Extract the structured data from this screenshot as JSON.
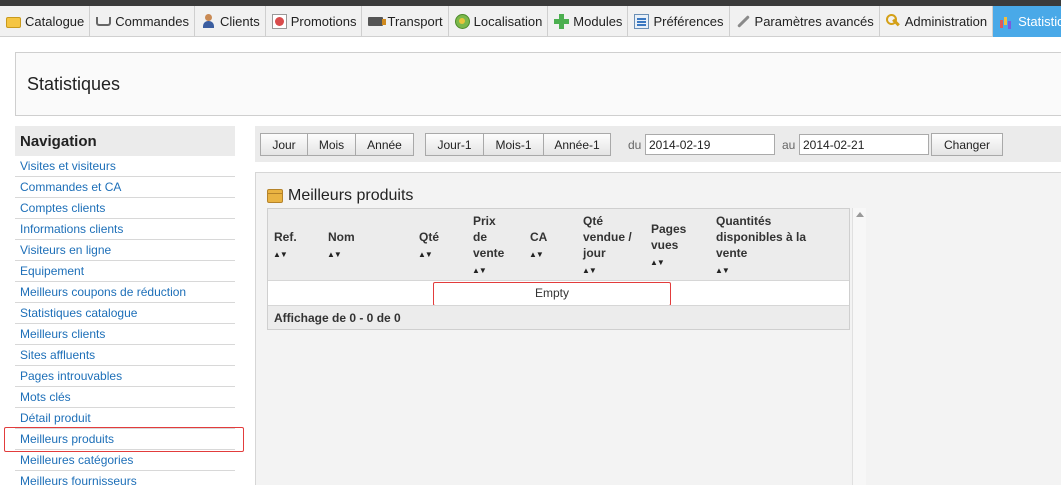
{
  "tabs": [
    {
      "label": "Catalogue",
      "icon": "folder-icon"
    },
    {
      "label": "Commandes",
      "icon": "cart-icon"
    },
    {
      "label": "Clients",
      "icon": "user-icon"
    },
    {
      "label": "Promotions",
      "icon": "promotion-icon"
    },
    {
      "label": "Transport",
      "icon": "truck-icon"
    },
    {
      "label": "Localisation",
      "icon": "globe-icon"
    },
    {
      "label": "Modules",
      "icon": "puzzle-icon"
    },
    {
      "label": "Préférences",
      "icon": "preferences-icon"
    },
    {
      "label": "Paramètres avancés",
      "icon": "wrench-icon"
    },
    {
      "label": "Administration",
      "icon": "key-icon"
    },
    {
      "label": "Statistiques",
      "icon": "stats-icon",
      "active": true
    }
  ],
  "page": {
    "title": "Statistiques"
  },
  "nav": {
    "title": "Navigation",
    "items": [
      "Visites et visiteurs",
      "Commandes et CA",
      "Comptes clients",
      "Informations clients",
      "Visiteurs en ligne",
      "Equipement",
      "Meilleurs coupons de réduction",
      "Statistiques catalogue",
      "Meilleurs clients",
      "Sites affluents",
      "Pages introuvables",
      "Mots clés",
      "Détail produit",
      "Meilleurs produits",
      "Meilleures catégories",
      "Meilleurs fournisseurs"
    ],
    "selected": "Meilleurs produits"
  },
  "toolbar": {
    "jour": "Jour",
    "mois": "Mois",
    "annee": "Année",
    "jour1": "Jour-1",
    "mois1": "Mois-1",
    "annee1": "Année-1",
    "du_label": "du",
    "du_value": "2014-02-19",
    "au_label": "au",
    "au_value": "2014-02-21",
    "changer": "Changer"
  },
  "section": {
    "title": "Meilleurs produits",
    "columns": {
      "ref": "Ref.",
      "nom": "Nom",
      "qte": "Qté",
      "prix1": "Prix",
      "prix2": "de",
      "prix3": "vente",
      "ca": "CA",
      "qv1": "Qté",
      "qv2": "vendue /",
      "qv3": "jour",
      "pv1": "Pages",
      "pv2": "vues",
      "qd1": "Quantités",
      "qd2": "disponibles à la",
      "qd3": "vente"
    },
    "empty": "Empty",
    "footer": "Affichage de 0 - 0 de 0"
  },
  "colors": {
    "accent": "#49a9e8",
    "link": "#1d6fb8",
    "highlight": "#e23c3c"
  }
}
